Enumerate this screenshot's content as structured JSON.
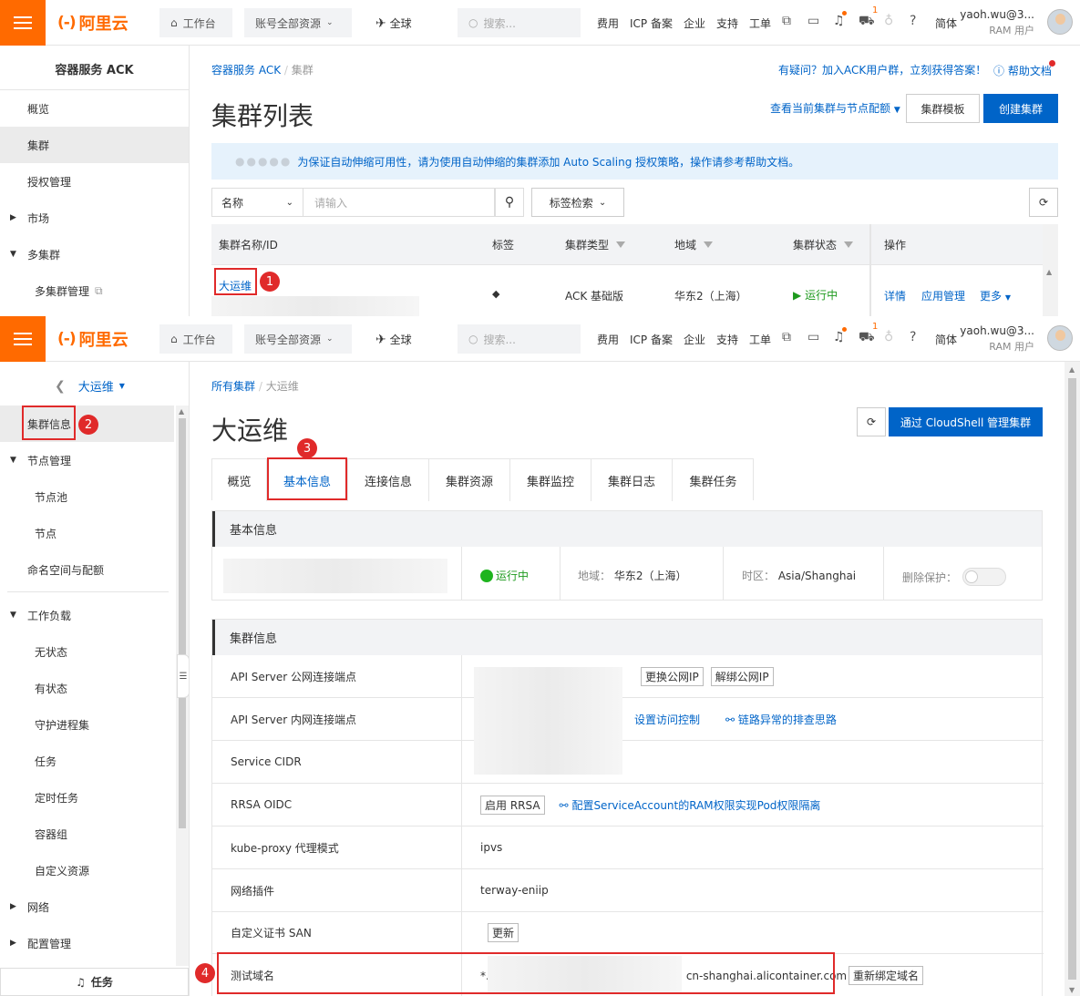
{
  "topbar": {
    "logo": "阿里云",
    "logo_mark": "(-)",
    "workbench": "工作台",
    "account_resources": "账号全部资源",
    "region": "全球",
    "search_placeholder": "搜索...",
    "nav": [
      "费用",
      "ICP 备案",
      "企业",
      "支持",
      "工单"
    ],
    "cart_count": "1",
    "lang": "简体",
    "user_name": "yaoh.wu@3...",
    "user_role": "RAM 用户"
  },
  "top_panel": {
    "sidebar_title": "容器服务 ACK",
    "sidebar_items": [
      "概览",
      "集群",
      "授权管理",
      "市场",
      "多集群",
      "多集群管理"
    ],
    "breadcrumb": [
      "容器服务 ACK",
      "集群"
    ],
    "help_text": "有疑问？加入ACK用户群，立刻获得答案！",
    "help_doc": "帮助文档",
    "page_title": "集群列表",
    "quota_link": "查看当前集群与节点配额",
    "template_button": "集群模板",
    "create_button": "创建集群",
    "notice": "为保证自动伸缩可用性，请为使用自动伸缩的集群添加 Auto Scaling 授权策略，操作请参考帮助文档。",
    "filter_select": "名称",
    "filter_placeholder": "请输入",
    "tag_search": "标签检索",
    "table_headers": [
      "集群名称/ID",
      "标签",
      "集群类型",
      "地域",
      "集群状态",
      "操作"
    ],
    "row": {
      "name": "大运维",
      "type": "ACK 基础版",
      "region": "华东2（上海）",
      "status": "运行中",
      "actions": [
        "详情",
        "应用管理",
        "更多"
      ]
    },
    "step": "1"
  },
  "bottom_panel": {
    "cluster_selector": "大运维",
    "sidebar_items": [
      {
        "label": "集群信息",
        "level": "top"
      },
      {
        "label": "节点管理",
        "level": "group"
      },
      {
        "label": "节点池",
        "level": "sub"
      },
      {
        "label": "节点",
        "level": "sub"
      },
      {
        "label": "命名空间与配额",
        "level": "top"
      },
      {
        "label": "工作负载",
        "level": "group"
      },
      {
        "label": "无状态",
        "level": "sub"
      },
      {
        "label": "有状态",
        "level": "sub"
      },
      {
        "label": "守护进程集",
        "level": "sub"
      },
      {
        "label": "任务",
        "level": "sub"
      },
      {
        "label": "定时任务",
        "level": "sub"
      },
      {
        "label": "容器组",
        "level": "sub"
      },
      {
        "label": "自定义资源",
        "level": "sub"
      },
      {
        "label": "网络",
        "level": "collapsed"
      },
      {
        "label": "配置管理",
        "level": "collapsed"
      }
    ],
    "task_button": "任务",
    "breadcrumb": [
      "所有集群",
      "大运维"
    ],
    "page_title": "大运维",
    "cloudshell_button": "通过 CloudShell 管理集群",
    "tabs": [
      "概览",
      "基本信息",
      "连接信息",
      "集群资源",
      "集群监控",
      "集群日志",
      "集群任务"
    ],
    "basic_section": "基本信息",
    "basic": {
      "status": "运行中",
      "region_label": "地域：",
      "region": "华东2（上海）",
      "tz_label": "时区：",
      "timezone": "Asia/Shanghai",
      "delete_protect": "删除保护："
    },
    "cluster_section": "集群信息",
    "rows": [
      {
        "label": "API Server 公网连接端点",
        "buttons": [
          "更换公网IP",
          "解绑公网IP"
        ]
      },
      {
        "label": "API Server 内网连接端点",
        "links": [
          "设置访问控制",
          "链路异常的排查思路"
        ]
      },
      {
        "label": "Service CIDR"
      },
      {
        "label": "RRSA OIDC",
        "buttons": [
          "启用 RRSA"
        ],
        "links": [
          "配置ServiceAccount的RAM权限实现Pod权限隔离"
        ]
      },
      {
        "label": "kube-proxy 代理模式",
        "value": "ipvs"
      },
      {
        "label": "网络插件",
        "value": "terway-eniip"
      },
      {
        "label": "自定义证书 SAN",
        "buttons": [
          "更新"
        ]
      },
      {
        "label": "测试域名",
        "value_prefix": "*.",
        "value": "cn-shanghai.alicontainer.com",
        "buttons": [
          "重新绑定域名"
        ]
      }
    ],
    "steps": [
      "2",
      "3",
      "4"
    ]
  },
  "colors": {
    "brand": "#ff6a00",
    "primary": "#0064c8",
    "success": "#1e9a1e",
    "annotation": "#e02a2a"
  }
}
